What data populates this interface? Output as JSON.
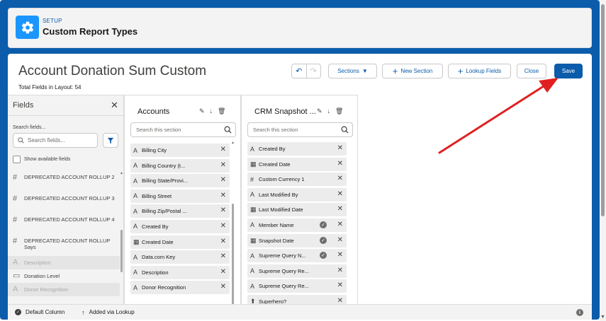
{
  "setup": {
    "label": "SETUP",
    "title": "Custom Report Types",
    "icon": "gear-icon"
  },
  "layout": {
    "title": "Account Donation Sum Custom",
    "count": "Total Fields in Layout: 54"
  },
  "toolbar": {
    "sections_label": "Sections",
    "new_section_label": "New Section",
    "lookup_fields_label": "Lookup Fields",
    "close_label": "Close",
    "save_label": "Save"
  },
  "fields_panel": {
    "title": "Fields",
    "search_label": "Search fields...",
    "search_placeholder": "Search fields...",
    "show_available": "Show available fields",
    "items": [
      {
        "icon": "#",
        "label": "DEPRECATED ACCOUNT ROLLUP 2",
        "disabled": false
      },
      {
        "icon": "#",
        "label": "DEPRECATED ACCOUNT ROLLUP 3",
        "disabled": false
      },
      {
        "icon": "#",
        "label": "DEPRECATED ACCOUNT ROLLUP 4",
        "disabled": false
      },
      {
        "icon": "#",
        "label": "DEPRECATED ACCOUNT ROLLUP Says",
        "disabled": false
      },
      {
        "icon": "A",
        "label": "Description",
        "disabled": true
      },
      {
        "icon": "▭",
        "label": "Donation Level",
        "disabled": false
      },
      {
        "icon": "A",
        "label": "Donor Recognition",
        "disabled": true
      }
    ]
  },
  "accounts": {
    "title": "Accounts",
    "search_placeholder": "Search this section",
    "items": [
      {
        "icon": "A",
        "label": "Billing City"
      },
      {
        "icon": "A",
        "label": "Billing Country (t..."
      },
      {
        "icon": "A",
        "label": "Billing State/Provi..."
      },
      {
        "icon": "A",
        "label": "Billing Street"
      },
      {
        "icon": "A",
        "label": "Billing Zip/Postal ..."
      },
      {
        "icon": "A",
        "label": "Created By"
      },
      {
        "icon": "▦",
        "label": "Created Date"
      },
      {
        "icon": "A",
        "label": "Data.com Key"
      },
      {
        "icon": "A",
        "label": "Description"
      },
      {
        "icon": "A",
        "label": "Donor Recognition"
      }
    ]
  },
  "crm": {
    "title": "CRM Snapshot ...",
    "search_placeholder": "Search this section",
    "items": [
      {
        "icon": "A",
        "label": "Created By",
        "default": false
      },
      {
        "icon": "▦",
        "label": "Created Date",
        "default": false
      },
      {
        "icon": "#",
        "label": "Custom Currency 1",
        "default": false
      },
      {
        "icon": "A",
        "label": "Last Modified By",
        "default": false
      },
      {
        "icon": "▦",
        "label": "Last Modified Date",
        "default": false
      },
      {
        "icon": "A",
        "label": "Member Name",
        "default": true
      },
      {
        "icon": "▦",
        "label": "Snapshot Date",
        "default": true
      },
      {
        "icon": "A",
        "label": "Supreme Query N...",
        "default": true
      },
      {
        "icon": "A",
        "label": "Supreme Query Re...",
        "default": false
      },
      {
        "icon": "A",
        "label": "Supreme Query Re...",
        "default": false
      },
      {
        "icon": "⬆",
        "label": "Superhero?",
        "default": false
      }
    ]
  },
  "footer": {
    "default_column": "Default Column",
    "added_via_lookup": "Added via Lookup"
  },
  "colors": {
    "brand": "#0b5cab",
    "accent": "#1b96ff",
    "annotation": "#e02020"
  }
}
